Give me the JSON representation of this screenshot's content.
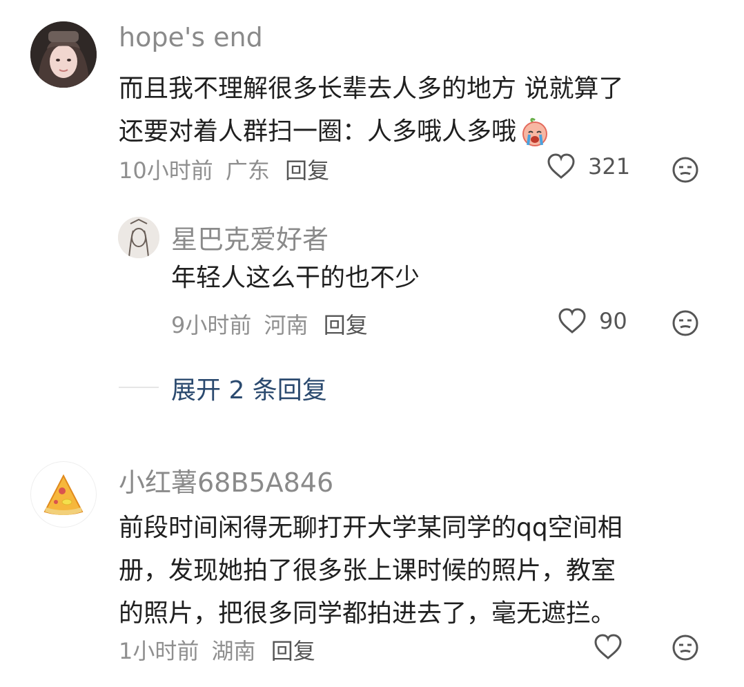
{
  "comments": [
    {
      "username": "hope's end",
      "avatar": "girl-portrait-photo",
      "lines": [
        "而且我不理解很多长辈去人多的地方 说就算了",
        "还要对着人群扫一圈：人多哦人多哦"
      ],
      "emoji": "crying-peach-sticker",
      "time": "10小时前",
      "location": "广东",
      "reply_label": "回复",
      "like_count": "321",
      "replies": [
        {
          "username": "星巴克爱好者",
          "avatar": "sketch-drawing",
          "text": "年轻人这么干的也不少",
          "time": "9小时前",
          "location": "河南",
          "reply_label": "回复",
          "like_count": "90"
        }
      ],
      "expand_label": "展开 2 条回复"
    },
    {
      "username": "小红薯68B5A846",
      "avatar": "pizza-slice",
      "lines": [
        "前段时间闲得无聊打开大学某同学的qq空间相",
        "册，发现她拍了很多张上课时候的照片，教室",
        "的照片，把很多同学都拍进去了，毫无遮拦。"
      ],
      "time": "1小时前",
      "location": "湖南",
      "reply_label": "回复",
      "like_count": ""
    }
  ]
}
